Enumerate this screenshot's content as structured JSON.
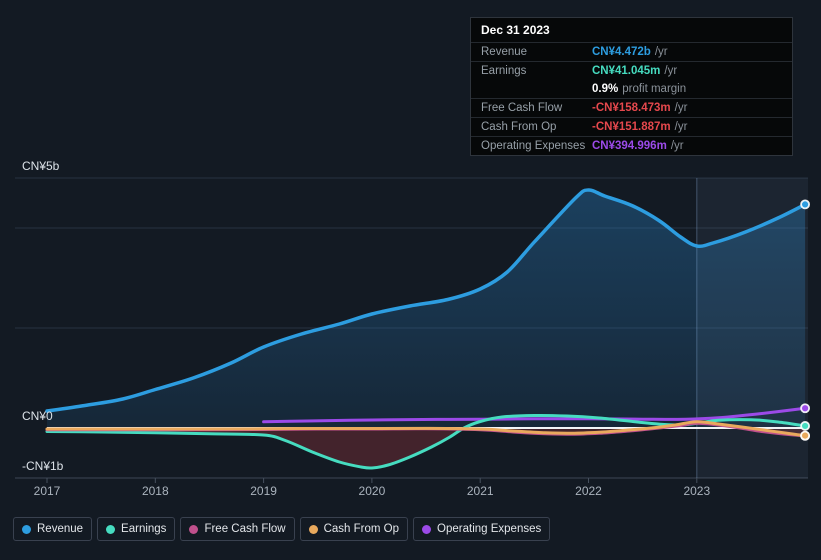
{
  "colors": {
    "background": "#131a23",
    "tooltip_bg": "#060809",
    "negative": "#e5484d",
    "zero_line": "#f2f5f8",
    "gridline": "#273140",
    "axis_line": "#3d4754",
    "tick": "#46505e",
    "y_label": "#dce2e8",
    "x_label": "#aab3bd",
    "highlight_band": "rgba(135,175,220,0.08)",
    "highlight_line": "rgba(150,190,235,0.35)"
  },
  "tooltip": {
    "date": "Dec 31 2023",
    "rows": [
      {
        "label": "Revenue",
        "value": "CN¥4.472b",
        "unit": "/yr"
      },
      {
        "label": "Earnings",
        "value": "CN¥41.045m",
        "unit": "/yr"
      },
      {
        "label": "Free Cash Flow",
        "value": "-CN¥158.473m",
        "unit": "/yr"
      },
      {
        "label": "Cash From Op",
        "value": "-CN¥151.887m",
        "unit": "/yr"
      },
      {
        "label": "Operating Expenses",
        "value": "CN¥394.996m",
        "unit": "/yr"
      }
    ],
    "profit_margin": {
      "value": "0.9%",
      "label": "profit margin"
    }
  },
  "chart_data": {
    "type": "line",
    "title": "",
    "y_unit": "CN¥ billions",
    "x_axis": {
      "ticks": [
        2017,
        2018,
        2019,
        2020,
        2021,
        2022,
        2023
      ],
      "range": [
        2017,
        2024
      ]
    },
    "y_axis": {
      "labels": [
        {
          "text": "CN¥5b",
          "value": 5
        },
        {
          "text": "CN¥0",
          "value": 0
        },
        {
          "text": "-CN¥1b",
          "value": -1
        }
      ],
      "gridline_values": [
        5,
        4,
        2
      ],
      "range": [
        -1,
        5
      ]
    },
    "highlight_from": 2023,
    "negative_fill_color": "rgba(170,55,65,0.32)",
    "negative_fills": [
      {
        "series": "Earnings",
        "from": 2017.0,
        "to": 2020.85
      },
      {
        "series": "Free Cash Flow",
        "from": 2021.0,
        "to": 2022.65
      },
      {
        "series": "Free Cash Flow",
        "from": 2023.4,
        "to": 2024.0
      }
    ],
    "series": [
      {
        "name": "Revenue",
        "color": "#2d9de0",
        "width": 3.5,
        "area": "gradient",
        "points": [
          [
            2017.0,
            0.34
          ],
          [
            2017.35,
            0.45
          ],
          [
            2017.7,
            0.58
          ],
          [
            2018.0,
            0.77
          ],
          [
            2018.35,
            1.0
          ],
          [
            2018.7,
            1.3
          ],
          [
            2019.0,
            1.62
          ],
          [
            2019.35,
            1.88
          ],
          [
            2019.7,
            2.08
          ],
          [
            2020.0,
            2.28
          ],
          [
            2020.35,
            2.44
          ],
          [
            2020.7,
            2.57
          ],
          [
            2021.0,
            2.78
          ],
          [
            2021.25,
            3.12
          ],
          [
            2021.5,
            3.72
          ],
          [
            2021.88,
            4.6
          ],
          [
            2022.0,
            4.76
          ],
          [
            2022.15,
            4.64
          ],
          [
            2022.4,
            4.45
          ],
          [
            2022.65,
            4.15
          ],
          [
            2022.85,
            3.82
          ],
          [
            2023.0,
            3.64
          ],
          [
            2023.15,
            3.7
          ],
          [
            2023.45,
            3.92
          ],
          [
            2023.75,
            4.2
          ],
          [
            2024.0,
            4.472
          ]
        ]
      },
      {
        "name": "Earnings",
        "color": "#46dcc0",
        "width": 3,
        "points": [
          [
            2017.0,
            -0.07
          ],
          [
            2017.5,
            -0.08
          ],
          [
            2018.0,
            -0.095
          ],
          [
            2018.5,
            -0.115
          ],
          [
            2019.0,
            -0.14
          ],
          [
            2019.2,
            -0.25
          ],
          [
            2019.45,
            -0.48
          ],
          [
            2019.7,
            -0.68
          ],
          [
            2019.9,
            -0.78
          ],
          [
            2020.0,
            -0.8
          ],
          [
            2020.15,
            -0.74
          ],
          [
            2020.35,
            -0.58
          ],
          [
            2020.55,
            -0.38
          ],
          [
            2020.72,
            -0.18
          ],
          [
            2020.85,
            0.0
          ],
          [
            2021.0,
            0.13
          ],
          [
            2021.2,
            0.22
          ],
          [
            2021.5,
            0.25
          ],
          [
            2021.8,
            0.24
          ],
          [
            2022.1,
            0.2
          ],
          [
            2022.45,
            0.12
          ],
          [
            2022.7,
            0.07
          ],
          [
            2022.87,
            0.06
          ],
          [
            2023.05,
            0.11
          ],
          [
            2023.2,
            0.155
          ],
          [
            2023.5,
            0.165
          ],
          [
            2023.75,
            0.12
          ],
          [
            2024.0,
            0.041
          ]
        ]
      },
      {
        "name": "Free Cash Flow",
        "color": "#c0508c",
        "width": 3,
        "points": [
          [
            2017.0,
            -0.035
          ],
          [
            2018.0,
            -0.035
          ],
          [
            2019.0,
            -0.03
          ],
          [
            2019.5,
            -0.02
          ],
          [
            2020.0,
            -0.02
          ],
          [
            2020.5,
            -0.015
          ],
          [
            2021.0,
            -0.035
          ],
          [
            2021.3,
            -0.08
          ],
          [
            2021.6,
            -0.115
          ],
          [
            2021.85,
            -0.125
          ],
          [
            2022.1,
            -0.105
          ],
          [
            2022.4,
            -0.055
          ],
          [
            2022.65,
            0.0
          ],
          [
            2022.85,
            0.05
          ],
          [
            2023.0,
            0.095
          ],
          [
            2023.2,
            0.06
          ],
          [
            2023.4,
            0.0
          ],
          [
            2023.6,
            -0.07
          ],
          [
            2023.8,
            -0.12
          ],
          [
            2024.0,
            -0.158
          ]
        ]
      },
      {
        "name": "Cash From Op",
        "color": "#e9a95d",
        "width": 3,
        "points": [
          [
            2017.0,
            -0.02
          ],
          [
            2018.0,
            -0.02
          ],
          [
            2019.0,
            -0.015
          ],
          [
            2019.5,
            -0.01
          ],
          [
            2020.0,
            -0.01
          ],
          [
            2020.5,
            -0.008
          ],
          [
            2021.0,
            -0.02
          ],
          [
            2021.3,
            -0.06
          ],
          [
            2021.6,
            -0.095
          ],
          [
            2021.85,
            -0.105
          ],
          [
            2022.1,
            -0.085
          ],
          [
            2022.4,
            -0.035
          ],
          [
            2022.6,
            0.005
          ],
          [
            2022.8,
            0.06
          ],
          [
            2023.0,
            0.125
          ],
          [
            2023.2,
            0.08
          ],
          [
            2023.45,
            0.01
          ],
          [
            2023.65,
            -0.05
          ],
          [
            2023.85,
            -0.11
          ],
          [
            2024.0,
            -0.152
          ]
        ]
      },
      {
        "name": "Operating Expenses",
        "color": "#9b4ae8",
        "width": 3,
        "points": [
          [
            2019.0,
            0.125
          ],
          [
            2019.4,
            0.14
          ],
          [
            2019.8,
            0.155
          ],
          [
            2020.2,
            0.165
          ],
          [
            2020.6,
            0.172
          ],
          [
            2021.0,
            0.176
          ],
          [
            2021.5,
            0.185
          ],
          [
            2022.0,
            0.185
          ],
          [
            2022.5,
            0.176
          ],
          [
            2022.9,
            0.175
          ],
          [
            2023.2,
            0.205
          ],
          [
            2023.6,
            0.29
          ],
          [
            2024.0,
            0.395
          ]
        ]
      }
    ]
  }
}
